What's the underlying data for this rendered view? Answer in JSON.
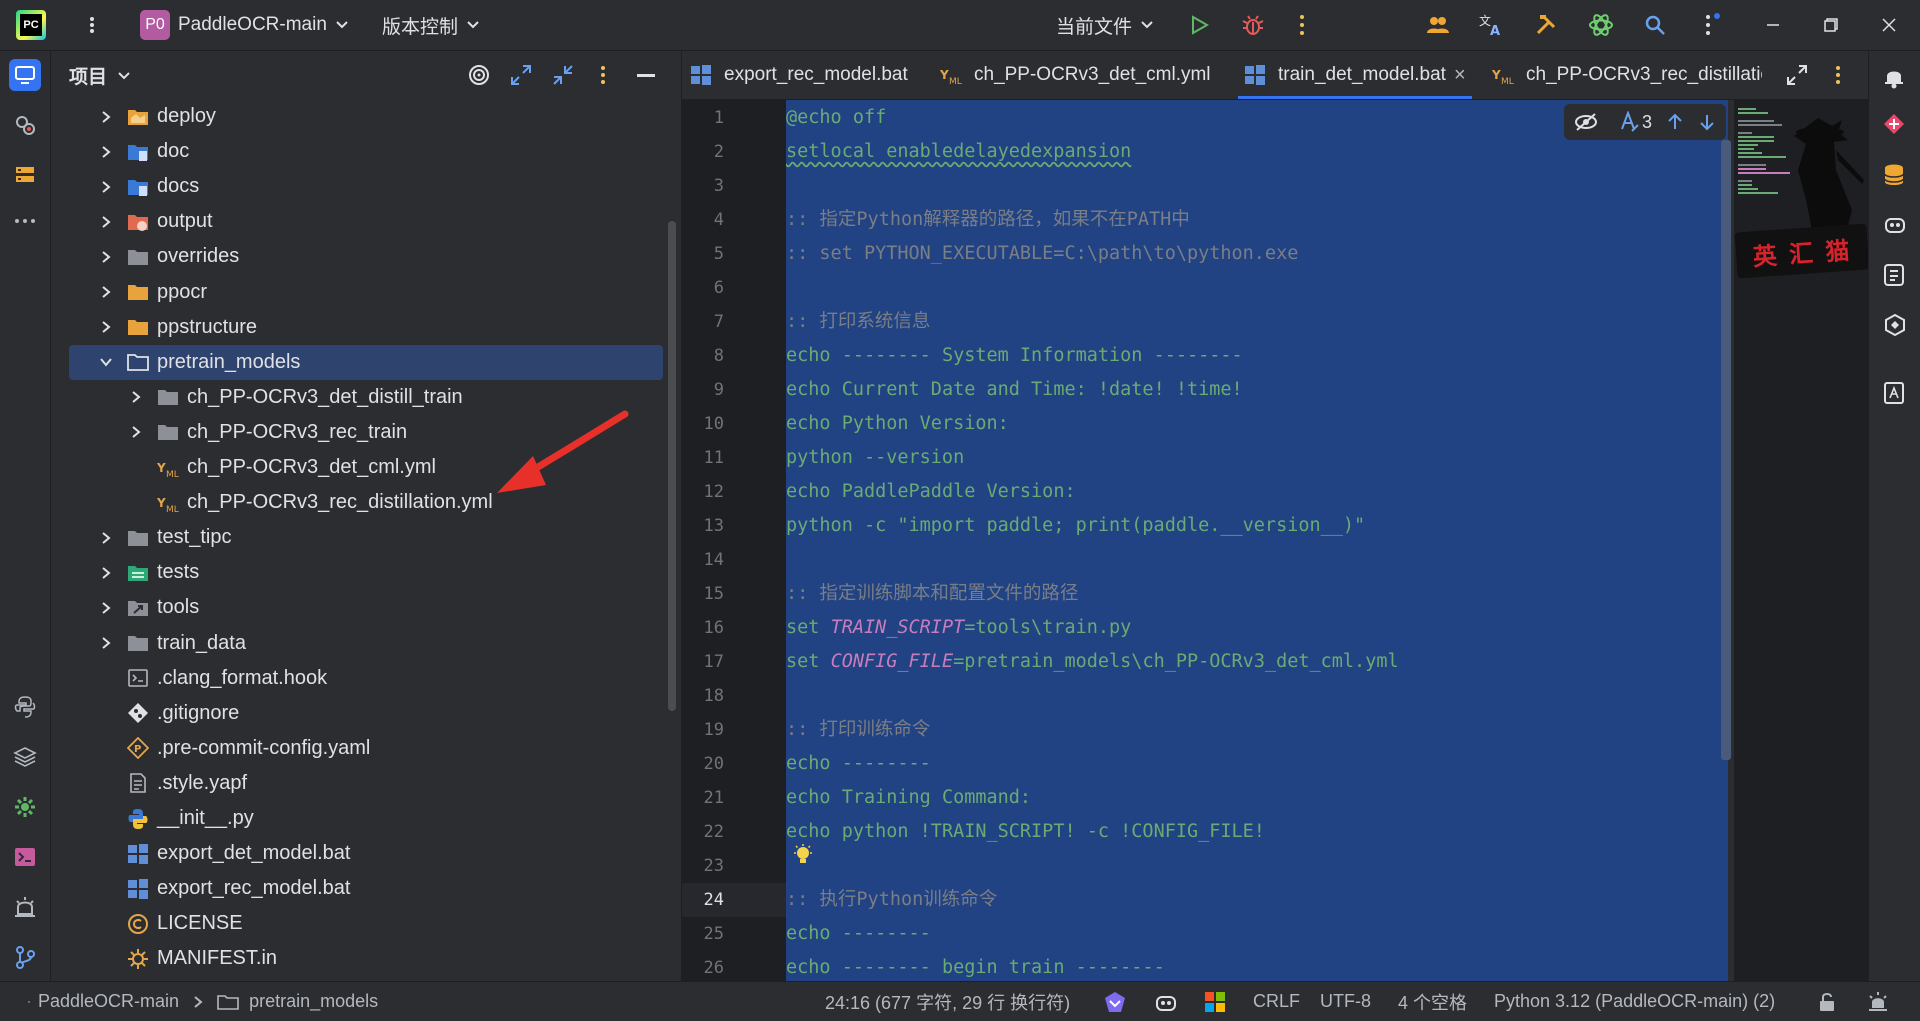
{
  "titlebar": {
    "logo": "PC",
    "project_badge": "P0",
    "project_name": "PaddleOCR-main",
    "vcs_label": "版本控制",
    "run_config": "当前文件",
    "icons": [
      "pycharm-logo",
      "menu-dots-icon",
      "chevron-down-icon",
      "run-icon",
      "debug-icon",
      "more-icon",
      "collab-icon",
      "translate-icon",
      "build-icon",
      "ai-icon",
      "search-icon",
      "settings-icon",
      "minimize-icon",
      "maximize-icon",
      "close-icon"
    ]
  },
  "left_strip": {
    "icons": [
      "project-icon",
      "commit-icon",
      "structure-icon",
      "more-tools-icon",
      "python-console-icon",
      "layers-icon",
      "services-icon",
      "terminal-icon",
      "problems-icon",
      "git-icon"
    ]
  },
  "project_panel": {
    "title": "项目",
    "tree": [
      {
        "label": "deploy",
        "kind": "folder-special",
        "depth": 0,
        "expandable": true
      },
      {
        "label": "doc",
        "kind": "folder-doc",
        "depth": 0,
        "expandable": true
      },
      {
        "label": "docs",
        "kind": "folder-doc",
        "depth": 0,
        "expandable": true
      },
      {
        "label": "output",
        "kind": "folder-excluded",
        "depth": 0,
        "expandable": true
      },
      {
        "label": "overrides",
        "kind": "folder",
        "depth": 0,
        "expandable": true
      },
      {
        "label": "ppocr",
        "kind": "folder-yellow",
        "depth": 0,
        "expandable": true
      },
      {
        "label": "ppstructure",
        "kind": "folder-yellow",
        "depth": 0,
        "expandable": true
      },
      {
        "label": "pretrain_models",
        "kind": "folder-open",
        "depth": 0,
        "expandable": true,
        "expanded": true,
        "selected": true
      },
      {
        "label": "ch_PP-OCRv3_det_distill_train",
        "kind": "folder",
        "depth": 1,
        "expandable": true
      },
      {
        "label": "ch_PP-OCRv3_rec_train",
        "kind": "folder",
        "depth": 1,
        "expandable": true
      },
      {
        "label": "ch_PP-OCRv3_det_cml.yml",
        "kind": "yaml",
        "depth": 1,
        "expandable": false
      },
      {
        "label": "ch_PP-OCRv3_rec_distillation.yml",
        "kind": "yaml",
        "depth": 1,
        "expandable": false
      },
      {
        "label": "test_tipc",
        "kind": "folder",
        "depth": 0,
        "expandable": true
      },
      {
        "label": "tests",
        "kind": "folder-test",
        "depth": 0,
        "expandable": true
      },
      {
        "label": "tools",
        "kind": "folder-link",
        "depth": 0,
        "expandable": true
      },
      {
        "label": "train_data",
        "kind": "folder",
        "depth": 0,
        "expandable": true
      },
      {
        "label": ".clang_format.hook",
        "kind": "file-terminal",
        "depth": 0,
        "expandable": false
      },
      {
        "label": ".gitignore",
        "kind": "file-git",
        "depth": 0,
        "expandable": false
      },
      {
        "label": ".pre-commit-config.yaml",
        "kind": "file-precommit",
        "depth": 0,
        "expandable": false
      },
      {
        "label": ".style.yapf",
        "kind": "file-text",
        "depth": 0,
        "expandable": false
      },
      {
        "label": "__init__.py",
        "kind": "file-python",
        "depth": 0,
        "expandable": false
      },
      {
        "label": "export_det_model.bat",
        "kind": "file-bat",
        "depth": 0,
        "expandable": false
      },
      {
        "label": "export_rec_model.bat",
        "kind": "file-bat",
        "depth": 0,
        "expandable": false
      },
      {
        "label": "LICENSE",
        "kind": "file-license",
        "depth": 0,
        "expandable": false
      },
      {
        "label": "MANIFEST.in",
        "kind": "file-manifest",
        "depth": 0,
        "expandable": false
      }
    ]
  },
  "editor_tabs": [
    {
      "label": "export_rec_model.bat",
      "kind": "file-bat",
      "active": false
    },
    {
      "label": "ch_PP-OCRv3_det_cml.yml",
      "kind": "yaml",
      "active": false
    },
    {
      "label": "train_det_model.bat",
      "kind": "file-bat",
      "active": true,
      "close": "×"
    },
    {
      "label": "ch_PP-OCRv3_rec_distillatio",
      "kind": "yaml",
      "active": false
    }
  ],
  "inspection": {
    "count": "3"
  },
  "current_line": "24",
  "code_lines": [
    {
      "n": "1",
      "parts": [
        {
          "t": "@echo off",
          "c": "kw"
        }
      ]
    },
    {
      "n": "2",
      "parts": [
        {
          "t": "setlocal enabledelayedexpansion",
          "c": "kw"
        }
      ]
    },
    {
      "n": "3",
      "parts": []
    },
    {
      "n": "4",
      "parts": [
        {
          "t": ":: 指定Python解释器的路径，如果不在PATH中",
          "c": "cm"
        }
      ]
    },
    {
      "n": "5",
      "parts": [
        {
          "t": ":: set PYTHON_EXECUTABLE=C:\\path\\to\\python.exe",
          "c": "cm"
        }
      ]
    },
    {
      "n": "6",
      "parts": []
    },
    {
      "n": "7",
      "parts": [
        {
          "t": ":: 打印系统信息",
          "c": "cm"
        }
      ]
    },
    {
      "n": "8",
      "parts": [
        {
          "t": "echo",
          "c": "kw"
        },
        {
          "t": " -------- System Information --------",
          "c": "str"
        }
      ]
    },
    {
      "n": "9",
      "parts": [
        {
          "t": "echo",
          "c": "kw"
        },
        {
          "t": " Current Date and Time: !date! !time!",
          "c": "str"
        }
      ]
    },
    {
      "n": "10",
      "parts": [
        {
          "t": "echo",
          "c": "kw"
        },
        {
          "t": " Python Version:",
          "c": "str"
        }
      ]
    },
    {
      "n": "11",
      "parts": [
        {
          "t": "python --version",
          "c": "kw"
        }
      ]
    },
    {
      "n": "12",
      "parts": [
        {
          "t": "echo",
          "c": "kw"
        },
        {
          "t": " PaddlePaddle Version:",
          "c": "str"
        }
      ]
    },
    {
      "n": "13",
      "parts": [
        {
          "t": "python -c \"import paddle; print(paddle.__version__)\"",
          "c": "kw"
        }
      ]
    },
    {
      "n": "14",
      "parts": []
    },
    {
      "n": "15",
      "parts": [
        {
          "t": ":: 指定训练脚本和配置文件的路径",
          "c": "cm"
        }
      ]
    },
    {
      "n": "16",
      "parts": [
        {
          "t": "set ",
          "c": "kw"
        },
        {
          "t": "TRAIN_SCRIPT",
          "c": "var"
        },
        {
          "t": "=tools\\train.py",
          "c": "kw"
        }
      ]
    },
    {
      "n": "17",
      "parts": [
        {
          "t": "set ",
          "c": "kw"
        },
        {
          "t": "CONFIG_FILE",
          "c": "var"
        },
        {
          "t": "=pretrain_models\\ch_PP-OCRv3_det_cml.yml",
          "c": "kw"
        }
      ]
    },
    {
      "n": "18",
      "parts": []
    },
    {
      "n": "19",
      "parts": [
        {
          "t": ":: 打印训练命令",
          "c": "cm"
        }
      ]
    },
    {
      "n": "20",
      "parts": [
        {
          "t": "echo",
          "c": "kw"
        },
        {
          "t": " --------",
          "c": "str"
        }
      ]
    },
    {
      "n": "21",
      "parts": [
        {
          "t": "echo",
          "c": "kw"
        },
        {
          "t": " Training Command:",
          "c": "str"
        }
      ]
    },
    {
      "n": "22",
      "parts": [
        {
          "t": "echo",
          "c": "kw"
        },
        {
          "t": " python !TRAIN_SCRIPT! -c !CONFIG_FILE!",
          "c": "str"
        }
      ]
    },
    {
      "n": "23",
      "parts": []
    },
    {
      "n": "24",
      "parts": [
        {
          "t": ":: 执行Python训练命令",
          "c": "cm"
        }
      ]
    },
    {
      "n": "25",
      "parts": [
        {
          "t": "echo",
          "c": "kw"
        },
        {
          "t": " --------",
          "c": "str"
        }
      ]
    },
    {
      "n": "26",
      "parts": [
        {
          "t": "echo",
          "c": "kw"
        },
        {
          "t": " -------- begin train --------",
          "c": "str"
        }
      ]
    }
  ],
  "overlay_badge": "英 汇 猫",
  "right_strip": {
    "icons": [
      "notifications-icon",
      "plugin-icon",
      "database-icon",
      "copilot-icon",
      "translate-panel-icon",
      "ai-assistant-icon",
      "readme-icon"
    ]
  },
  "statusbar": {
    "breadcrumb": [
      "PaddleOCR-main",
      "pretrain_models"
    ],
    "position": "24:16 (677 字符, 29 行 换行符)",
    "line_sep": "CRLF",
    "encoding": "UTF-8",
    "indent": "4 个空格",
    "interpreter": "Python 3.12 (PaddleOCR-main) (2)"
  },
  "colors": {
    "accent": "#3574f0",
    "selection": "#214283",
    "code_green": "#6aab73",
    "arrow": "#e8302b"
  }
}
